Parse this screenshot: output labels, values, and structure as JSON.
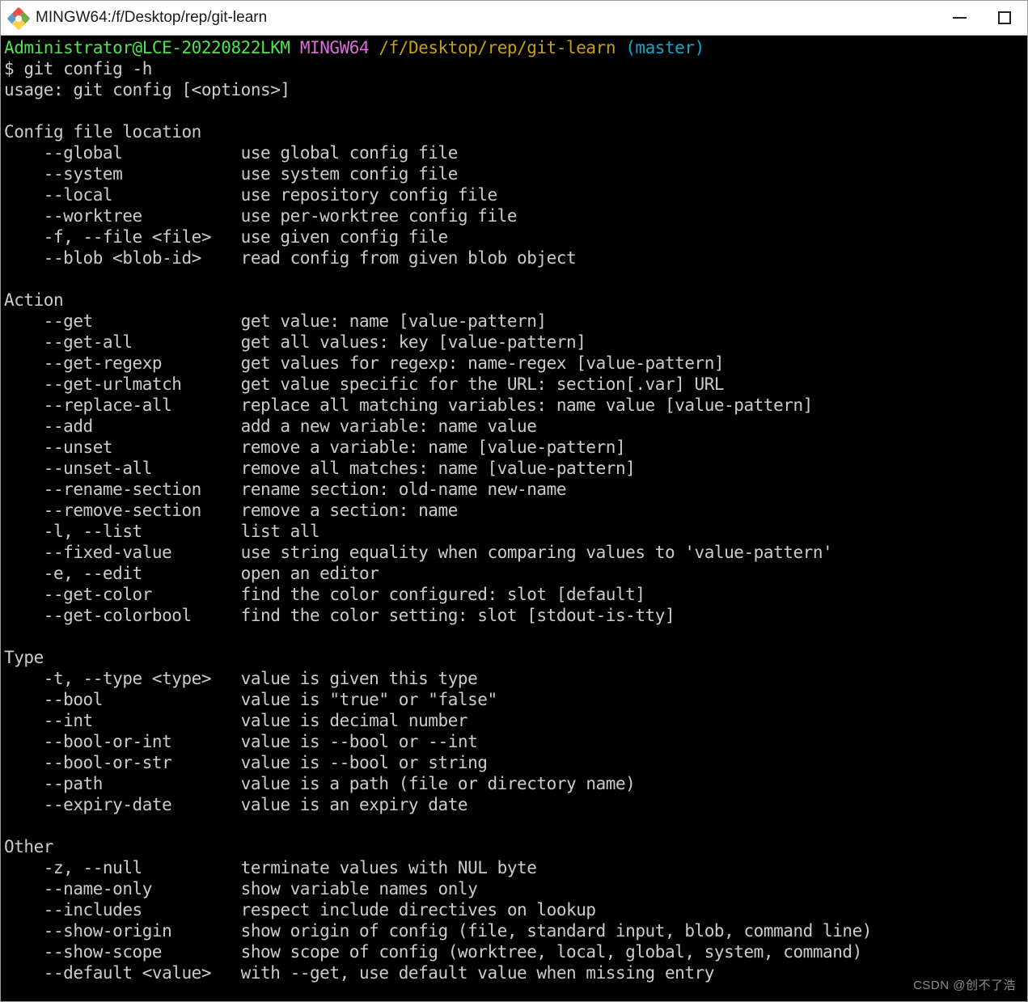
{
  "window": {
    "title": "MINGW64:/f/Desktop/rep/git-learn",
    "icon": "mingw-diamond-icon",
    "buttons": {
      "minimize": "minimize-icon",
      "maximize": "maximize-icon"
    }
  },
  "colors": {
    "background": "#000000",
    "foreground": "#cccccc",
    "user_host": "#4ee44e",
    "shell_tag": "#d670d6",
    "path": "#c5a017",
    "branch": "#11a8cd",
    "titlebar_bg": "#ffffff"
  },
  "prompt": {
    "user_host": "Administrator@LCE-20220822LKM",
    "shell": "MINGW64",
    "path": "/f/Desktop/rep/git-learn",
    "branch": "(master)",
    "sigil": "$",
    "command": "git config -h"
  },
  "output": {
    "usage": "usage: git config [<options>]",
    "sections": [
      {
        "heading": "Config file location",
        "options": [
          {
            "flag": "--global",
            "desc": "use global config file"
          },
          {
            "flag": "--system",
            "desc": "use system config file"
          },
          {
            "flag": "--local",
            "desc": "use repository config file"
          },
          {
            "flag": "--worktree",
            "desc": "use per-worktree config file"
          },
          {
            "flag": "-f, --file <file>",
            "desc": "use given config file"
          },
          {
            "flag": "--blob <blob-id>",
            "desc": "read config from given blob object"
          }
        ]
      },
      {
        "heading": "Action",
        "options": [
          {
            "flag": "--get",
            "desc": "get value: name [value-pattern]"
          },
          {
            "flag": "--get-all",
            "desc": "get all values: key [value-pattern]"
          },
          {
            "flag": "--get-regexp",
            "desc": "get values for regexp: name-regex [value-pattern]"
          },
          {
            "flag": "--get-urlmatch",
            "desc": "get value specific for the URL: section[.var] URL"
          },
          {
            "flag": "--replace-all",
            "desc": "replace all matching variables: name value [value-pattern]"
          },
          {
            "flag": "--add",
            "desc": "add a new variable: name value"
          },
          {
            "flag": "--unset",
            "desc": "remove a variable: name [value-pattern]"
          },
          {
            "flag": "--unset-all",
            "desc": "remove all matches: name [value-pattern]"
          },
          {
            "flag": "--rename-section",
            "desc": "rename section: old-name new-name"
          },
          {
            "flag": "--remove-section",
            "desc": "remove a section: name"
          },
          {
            "flag": "-l, --list",
            "desc": "list all"
          },
          {
            "flag": "--fixed-value",
            "desc": "use string equality when comparing values to 'value-pattern'"
          },
          {
            "flag": "-e, --edit",
            "desc": "open an editor"
          },
          {
            "flag": "--get-color",
            "desc": "find the color configured: slot [default]"
          },
          {
            "flag": "--get-colorbool",
            "desc": "find the color setting: slot [stdout-is-tty]"
          }
        ]
      },
      {
        "heading": "Type",
        "options": [
          {
            "flag": "-t, --type <type>",
            "desc": "value is given this type"
          },
          {
            "flag": "--bool",
            "desc": "value is \"true\" or \"false\""
          },
          {
            "flag": "--int",
            "desc": "value is decimal number"
          },
          {
            "flag": "--bool-or-int",
            "desc": "value is --bool or --int"
          },
          {
            "flag": "--bool-or-str",
            "desc": "value is --bool or string"
          },
          {
            "flag": "--path",
            "desc": "value is a path (file or directory name)"
          },
          {
            "flag": "--expiry-date",
            "desc": "value is an expiry date"
          }
        ]
      },
      {
        "heading": "Other",
        "options": [
          {
            "flag": "-z, --null",
            "desc": "terminate values with NUL byte"
          },
          {
            "flag": "--name-only",
            "desc": "show variable names only"
          },
          {
            "flag": "--includes",
            "desc": "respect include directives on lookup"
          },
          {
            "flag": "--show-origin",
            "desc": "show origin of config (file, standard input, blob, command line)"
          },
          {
            "flag": "--show-scope",
            "desc": "show scope of config (worktree, local, global, system, command)"
          },
          {
            "flag": "--default <value>",
            "desc": "with --get, use default value when missing entry"
          }
        ]
      }
    ]
  },
  "watermark": "CSDN @创不了浩"
}
